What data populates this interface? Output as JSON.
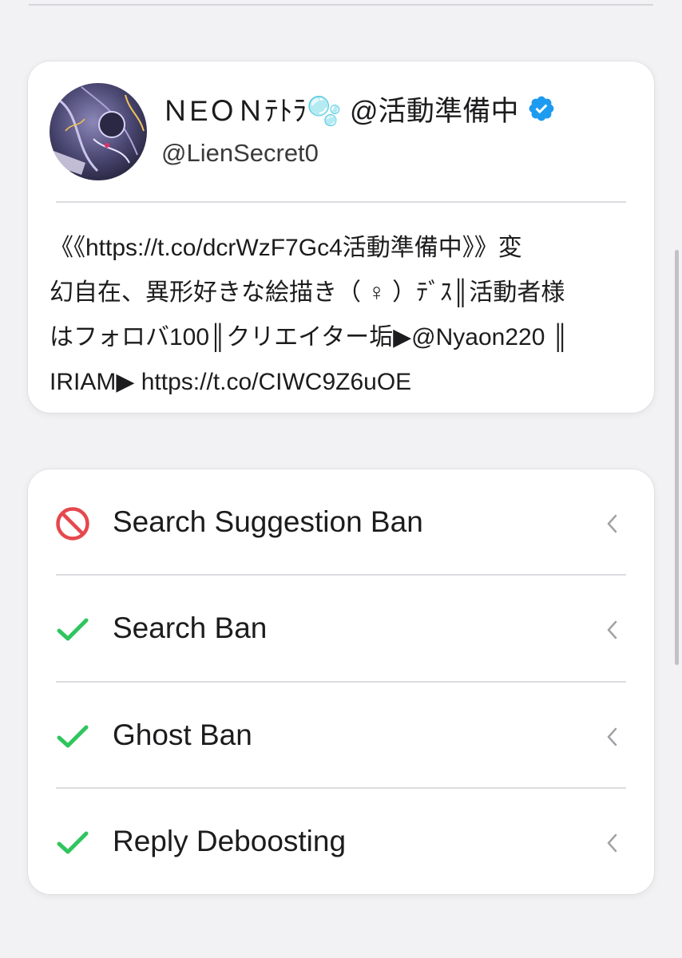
{
  "profile": {
    "display_name": "ＮΕＯＮﾃﾄﾗ🫧 @活動準備中",
    "handle": "@LienSecret0",
    "bio_lines": [
      "《《https://t.co/dcrWzF7Gc4活動準備中》》変",
      "幻自在、異形好きな絵描き（ ♀ ）ﾃﾞｽ║活動者様",
      "はフォロバ100║クリエイター垢▶@Nyaon220 ║",
      "IRIAM▶ https://t.co/CIWC9Z6uOE"
    ],
    "verified_icon": "verified-badge-icon",
    "verified_color": "#1d9bf0"
  },
  "status_checks": [
    {
      "label": "Search Suggestion Ban",
      "status": "banned",
      "icon": "prohibited-icon",
      "color": "#e5484d"
    },
    {
      "label": "Search Ban",
      "status": "ok",
      "icon": "checkmark-icon",
      "color": "#30c55e"
    },
    {
      "label": "Ghost Ban",
      "status": "ok",
      "icon": "checkmark-icon",
      "color": "#30c55e"
    },
    {
      "label": "Reply Deboosting",
      "status": "ok",
      "icon": "checkmark-icon",
      "color": "#30c55e"
    }
  ]
}
